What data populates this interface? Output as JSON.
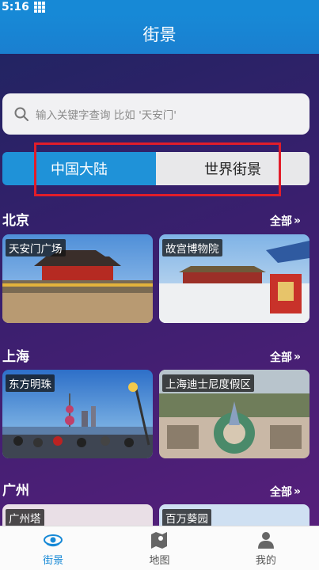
{
  "status": {
    "time": "5:16"
  },
  "header": {
    "title": "街景"
  },
  "search": {
    "placeholder": "输入关键字查询 比如 '天安门'"
  },
  "tabs": {
    "active": "中国大陆",
    "inactive": "世界街景"
  },
  "more_label": "全部",
  "sections": [
    {
      "title": "北京",
      "cards": [
        "天安门广场",
        "故宫博物院"
      ]
    },
    {
      "title": "上海",
      "cards": [
        "东方明珠",
        "上海迪士尼度假区"
      ]
    },
    {
      "title": "广州",
      "cards": [
        "广州塔",
        "百万葵园"
      ]
    }
  ],
  "nav": [
    {
      "label": "街景",
      "icon": "eye-icon",
      "active": true
    },
    {
      "label": "地图",
      "icon": "map-icon",
      "active": false
    },
    {
      "label": "我的",
      "icon": "person-icon",
      "active": false
    }
  ],
  "colors": {
    "accent": "#1789d6",
    "highlight": "#e11d2a"
  }
}
